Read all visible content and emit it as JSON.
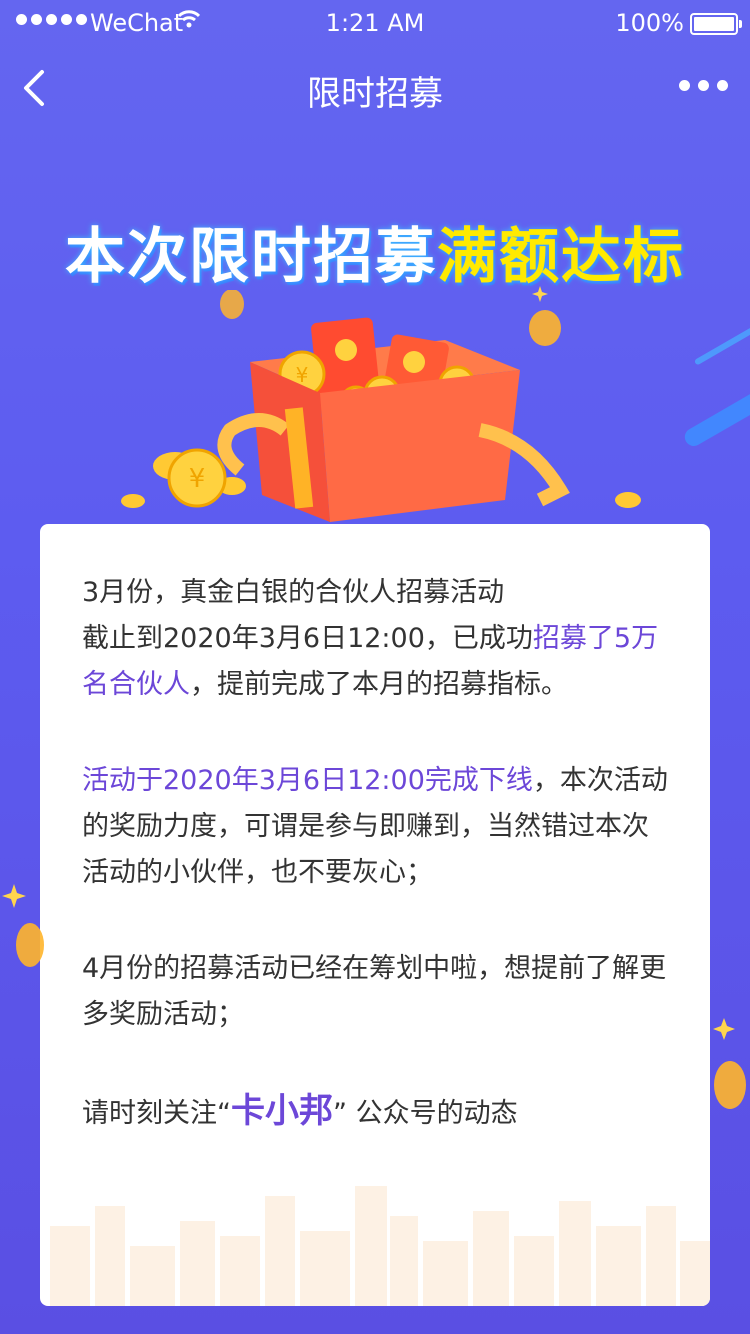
{
  "status_bar": {
    "carrier": "WeChat",
    "time": "1:21 AM",
    "battery": "100%"
  },
  "nav": {
    "title": "限时招募"
  },
  "headline": {
    "part1": "本次限时招募",
    "highlight": "满额达标"
  },
  "content": {
    "para1_line1": "3月份，真金白银的合伙人招募活动",
    "para1_line2_prefix": "截止到2020年3月6日12:00，已成功",
    "para1_highlight": "招募了5万名合伙人",
    "para1_suffix": "，提前完成了本月的招募指标。",
    "para2_highlight": "活动于2020年3月6日12:00完成下线",
    "para2_suffix": "，本次活动的奖励力度，可谓是参与即赚到，当然错过本次活动的小伙伴，也不要灰心；",
    "para3": "4月份的招募活动已经在筹划中啦，想提前了解更多奖励活动；",
    "para4_prefix": "请时刻关注",
    "para4_quote_open": "“",
    "para4_brand": "卡小邦",
    "para4_quote_close": "”",
    "para4_suffix": " 公众号的动态"
  },
  "colors": {
    "background": "#5d5cf0",
    "accent": "#6c47d8",
    "headline_highlight": "#ffea00",
    "gift_box": "#f5503a"
  }
}
